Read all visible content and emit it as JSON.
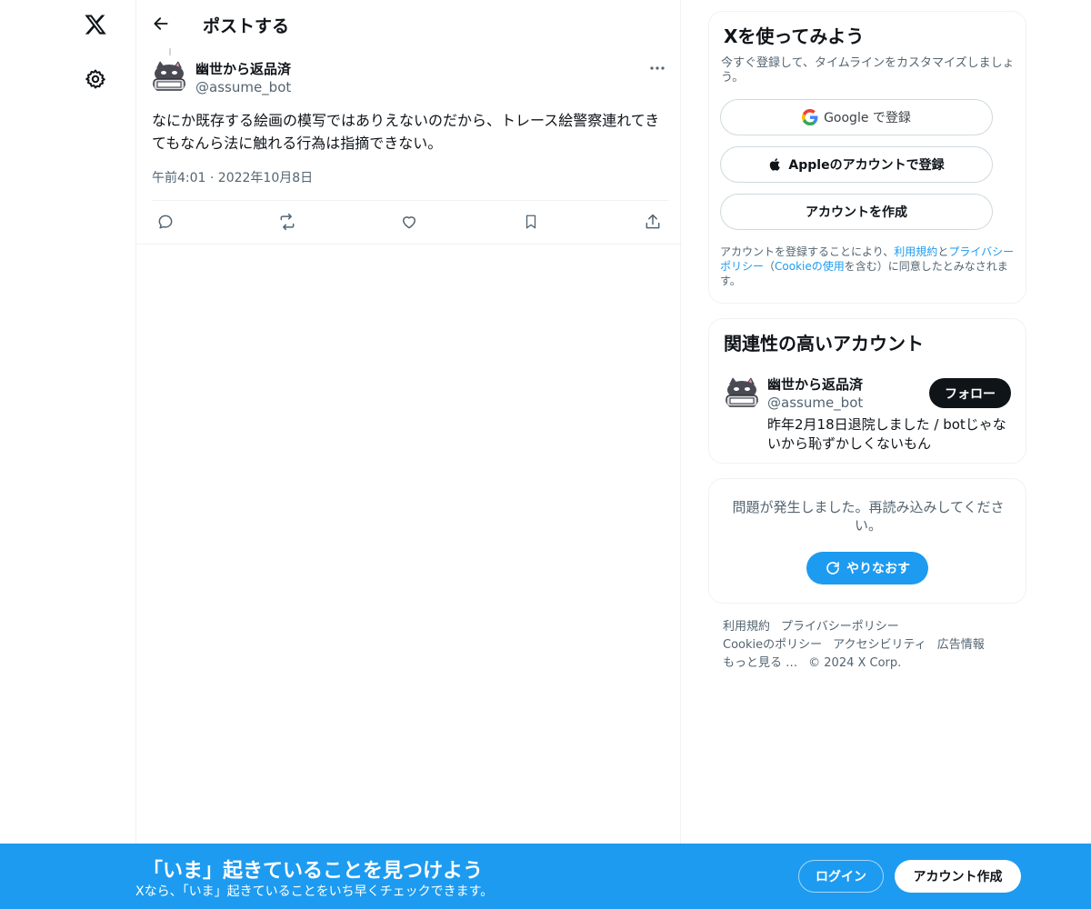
{
  "nav": {
    "logo_icon": "x-logo-icon",
    "settings_icon": "gear-icon"
  },
  "header": {
    "title": "ポストする",
    "back_icon": "arrow-left-icon"
  },
  "post": {
    "author_name": "幽世から返品済",
    "author_handle": "@assume_bot",
    "text": "なにか既存する絵画の模写ではありえないのだから、トレース絵警察連れてきてもなんら法に触れる行為は指摘できない。",
    "timestamp": "午前4:01 · 2022年10月8日",
    "actions": [
      "reply-icon",
      "repost-icon",
      "like-icon",
      "bookmark-icon",
      "share-icon"
    ]
  },
  "signup": {
    "title": "Xを使ってみよう",
    "subtitle": "今すぐ登録して、タイムラインをカスタマイズしましょう。",
    "google_label": "Google で登録",
    "apple_label": "Appleのアカウントで登録",
    "create_label": "アカウントを作成",
    "terms_prefix": "アカウントを登録することにより、",
    "terms_link": "利用規約",
    "terms_and": "と",
    "privacy_link": "プライバシーポリシー",
    "terms_paren_open": "（",
    "cookie_link": "Cookieの使用",
    "terms_suffix": "を含む）に同意したとみなされます。"
  },
  "related": {
    "title": "関連性の高いアカウント",
    "name": "幽世から返品済",
    "handle": "@assume_bot",
    "bio": "昨年2月18日退院しました / botじゃないから恥ずかしくないもん",
    "follow_label": "フォロー"
  },
  "error_card": {
    "message": "問題が発生しました。再読み込みしてください。",
    "retry_label": "やりなおす"
  },
  "footer": {
    "links_line1": [
      "利用規約",
      "プライバシーポリシー"
    ],
    "links_line2": [
      "Cookieのポリシー",
      "アクセシビリティ",
      "広告情報"
    ],
    "more": "もっと見る …",
    "copyright": "© 2024 X Corp."
  },
  "banner": {
    "title": "「いま」起きていることを見つけよう",
    "subtitle": "Xなら、「いま」起きていることをいち早くチェックできます。",
    "login_label": "ログイン",
    "create_label": "アカウント作成"
  },
  "colors": {
    "accent": "#1d9bf0",
    "text": "#0f1419",
    "muted": "#536471",
    "border": "#eff3f4"
  }
}
